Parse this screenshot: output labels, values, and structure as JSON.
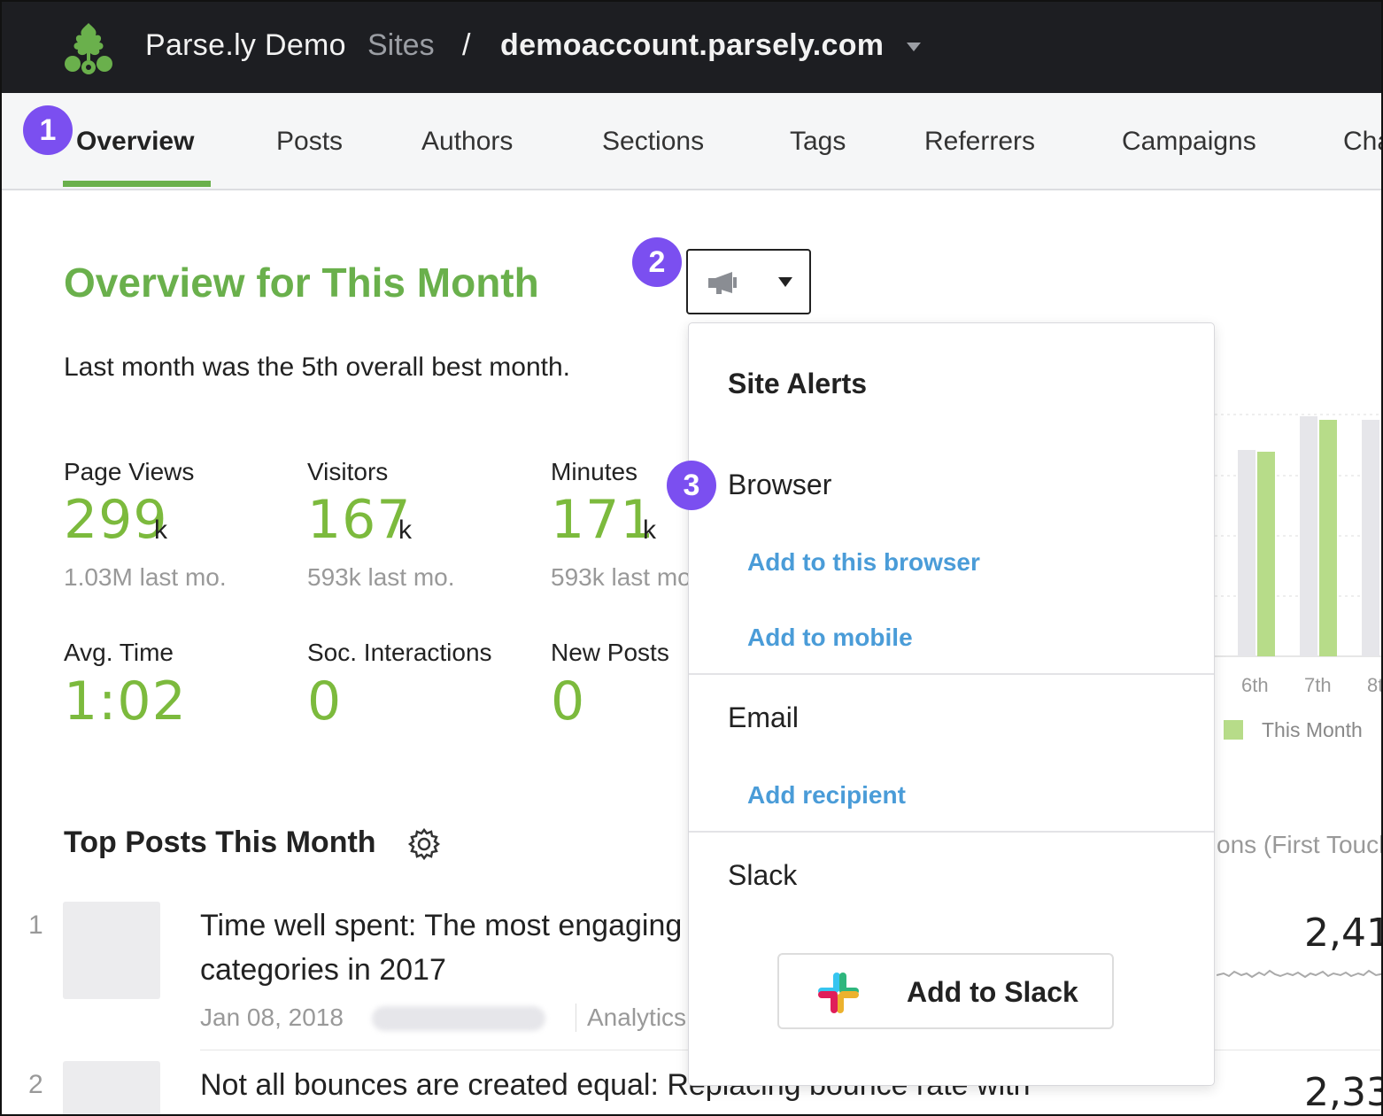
{
  "header": {
    "org_name": "Parse.ly Demo",
    "sites_label": "Sites",
    "separator": "/",
    "domain": "demoaccount.parsely.com"
  },
  "nav": {
    "tabs": [
      {
        "label": "Overview",
        "active": true
      },
      {
        "label": "Posts"
      },
      {
        "label": "Authors"
      },
      {
        "label": "Sections"
      },
      {
        "label": "Tags"
      },
      {
        "label": "Referrers"
      },
      {
        "label": "Campaigns"
      },
      {
        "label": "Cha"
      }
    ]
  },
  "steps": [
    "1",
    "2",
    "3"
  ],
  "overview": {
    "title": "Overview for This Month",
    "subtitle": "Last month was the 5th overall best month.",
    "metrics": [
      {
        "label": "Page Views",
        "value": "299",
        "unit": "k",
        "sub": "1.03M last mo."
      },
      {
        "label": "Visitors",
        "value": "167",
        "unit": "k",
        "sub": "593k last mo."
      },
      {
        "label": "Minutes",
        "value": "171",
        "unit": "k",
        "sub": "593k last mo."
      },
      {
        "label": "Avg. Time",
        "value": "1:02"
      },
      {
        "label": "Soc. Interactions",
        "value": "0"
      },
      {
        "label": "New Posts",
        "value": "0"
      }
    ]
  },
  "chart": {
    "ticks": [
      "6th",
      "7th",
      "8t"
    ],
    "legend": "This Month",
    "colors": {
      "last_month": "#e6e6ea",
      "this_month": "#b7dc89"
    }
  },
  "top_posts": {
    "title": "Top Posts This Month",
    "conversions_header": "ons (First Touch",
    "posts": [
      {
        "rank": "1",
        "title": "Time well spent: The most engaging categories in 2017",
        "date": "Jan 08, 2018",
        "section": "Analytics",
        "metric": "2,41"
      },
      {
        "rank": "2",
        "title": "Not all bounces are created equal: Replacing bounce rate with",
        "metric": "2,33"
      }
    ]
  },
  "alerts_menu": {
    "title": "Site Alerts",
    "browser": {
      "label": "Browser",
      "add_browser": "Add to this browser",
      "add_mobile": "Add to mobile"
    },
    "email": {
      "label": "Email",
      "add_recipient": "Add recipient"
    },
    "slack": {
      "label": "Slack",
      "button": "Add to Slack"
    }
  },
  "colors": {
    "accent": "#6ab04c",
    "link": "#4a9cd8",
    "step_badge": "#7b4ff0",
    "topbar": "#1d1e22"
  }
}
